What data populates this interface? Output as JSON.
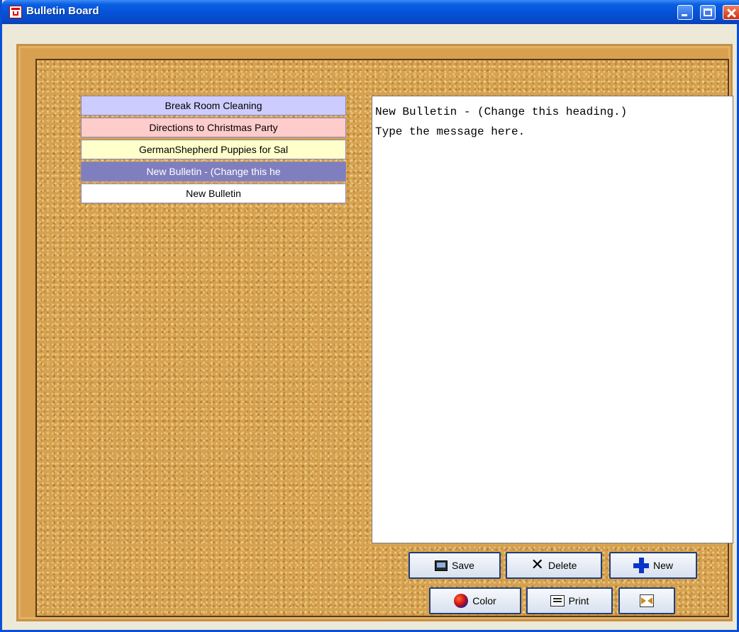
{
  "window": {
    "title": "Bulletin Board"
  },
  "bulletins": [
    {
      "label": "Break Room Cleaning",
      "bg": "#ccccff",
      "color": "#000000"
    },
    {
      "label": "Directions to Christmas Party",
      "bg": "#ffcccc",
      "color": "#000000"
    },
    {
      "label": "GermanShepherd Puppies for Sal",
      "bg": "#ffffcc",
      "color": "#000000"
    },
    {
      "label": "New Bulletin - (Change this he",
      "bg": "#7f7fbf",
      "color": "#ffffff"
    },
    {
      "label": "New Bulletin",
      "bg": "#ffffff",
      "color": "#000000"
    }
  ],
  "message": {
    "heading": "New Bulletin - (Change this heading.)",
    "body": "Type the message here."
  },
  "buttons": {
    "save": "Save",
    "delete": "Delete",
    "new": "New",
    "color": "Color",
    "print": "Print"
  },
  "icons": {
    "save": "computer-icon",
    "delete": "x-icon",
    "new": "plus-icon",
    "color": "color-ball-icon",
    "print": "printer-icon",
    "exit": "exit-icon"
  }
}
